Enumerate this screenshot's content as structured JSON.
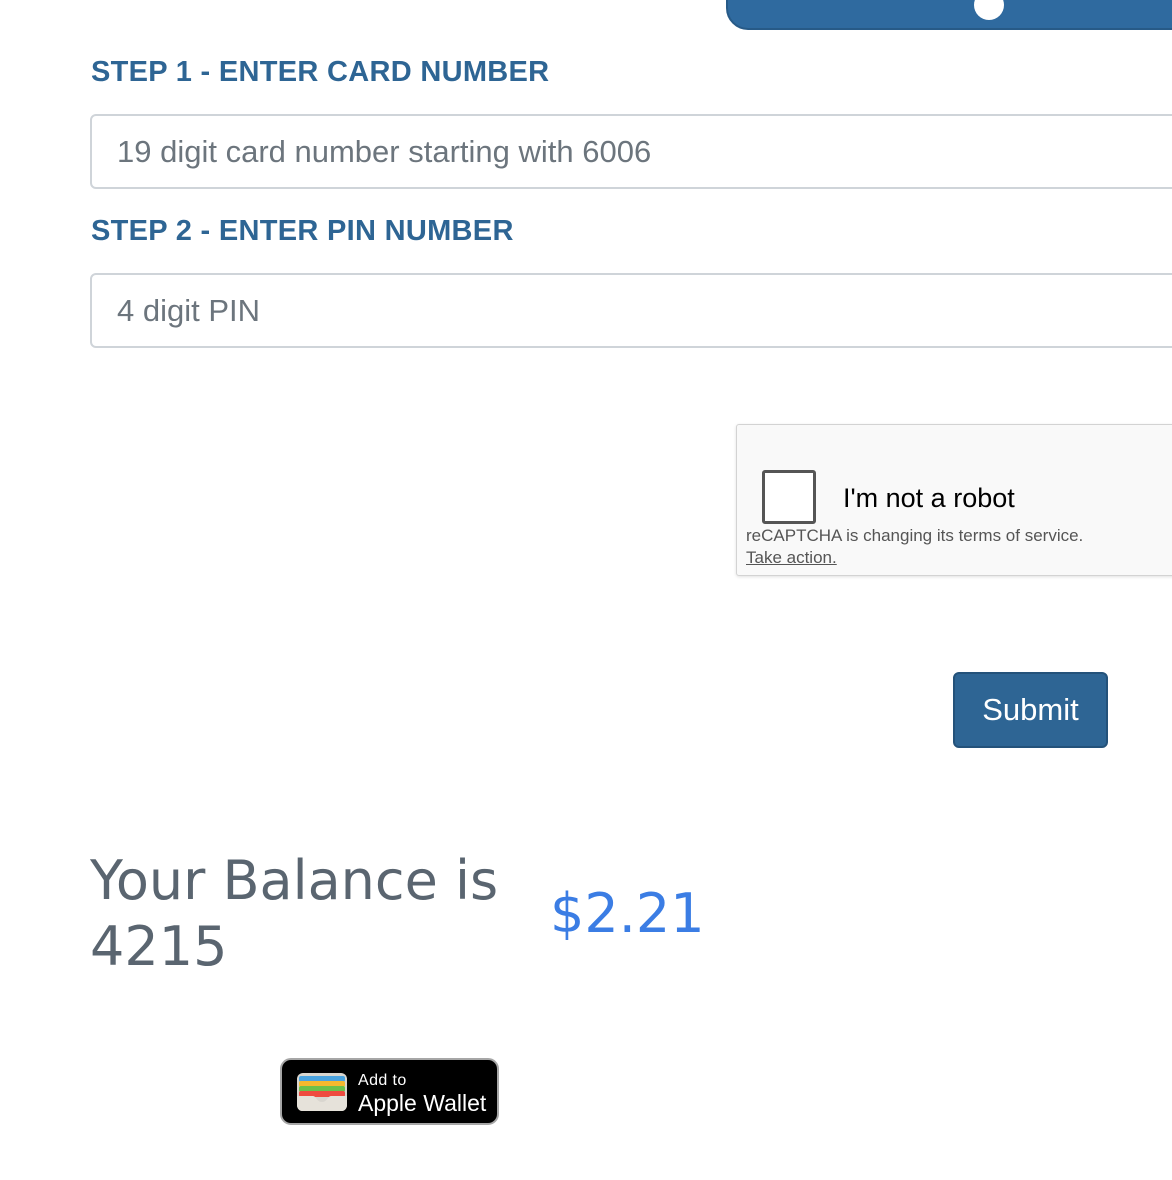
{
  "colors": {
    "accent": "#2e6594",
    "balance_amount": "#3b7de4",
    "balance_label": "#5a6570"
  },
  "form": {
    "step1_label": "STEP 1 - ENTER CARD NUMBER",
    "card_placeholder": "19 digit card number starting with 6006",
    "card_value": "",
    "step2_label": "STEP 2 - ENTER PIN NUMBER",
    "pin_placeholder": "4 digit PIN",
    "pin_value": "",
    "submit_label": "Submit"
  },
  "recaptcha": {
    "label": "I'm not a robot",
    "terms_text": "reCAPTCHA is changing its terms of service.",
    "action_link": "Take action.",
    "checked": false
  },
  "balance": {
    "label": "Your Balance is 4215",
    "amount": "$2.21"
  },
  "wallet": {
    "small_text": "Add to",
    "large_text": "Apple Wallet",
    "icon": "wallet-icon"
  }
}
